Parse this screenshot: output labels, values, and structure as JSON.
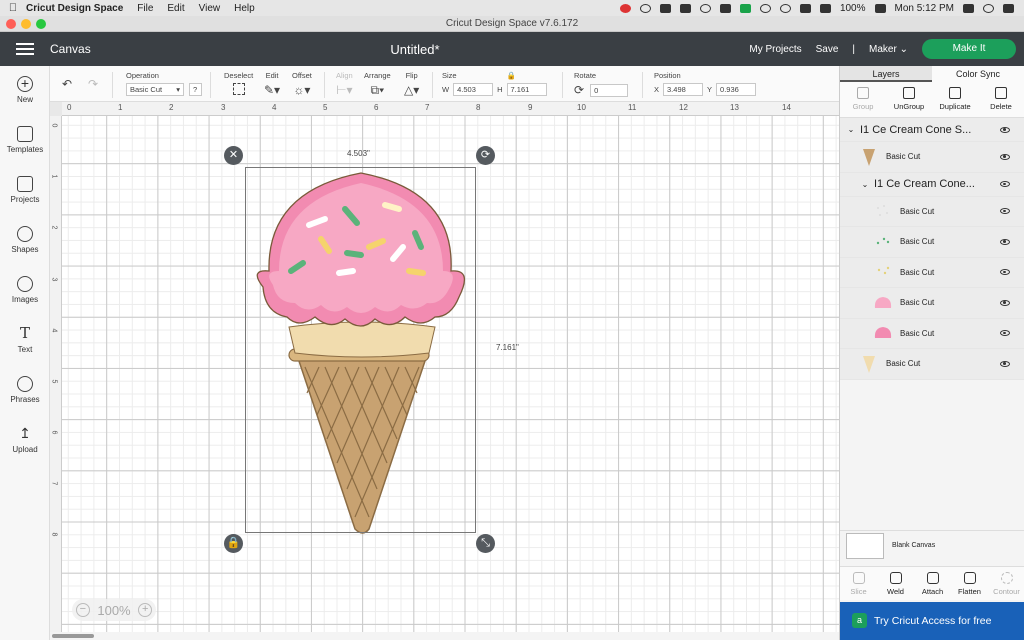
{
  "menubar": {
    "app": "Cricut Design Space",
    "items": [
      "File",
      "Edit",
      "View",
      "Help"
    ],
    "battery": "100%",
    "clock": "Mon 5:12 PM"
  },
  "window": {
    "title": "Cricut Design Space  v7.6.172"
  },
  "header": {
    "section": "Canvas",
    "doc_title": "Untitled*",
    "my_projects": "My Projects",
    "save": "Save",
    "divider": "|",
    "machine": "Maker",
    "make_it": "Make It"
  },
  "lefttools": [
    {
      "label": "New",
      "icon": "plus-icon"
    },
    {
      "label": "Templates",
      "icon": "shirt-icon"
    },
    {
      "label": "Projects",
      "icon": "clipboard-icon"
    },
    {
      "label": "Shapes",
      "icon": "shapes-icon"
    },
    {
      "label": "Images",
      "icon": "lightbulb-icon"
    },
    {
      "label": "Text",
      "icon": "text-icon"
    },
    {
      "label": "Phrases",
      "icon": "speech-bubble-icon"
    },
    {
      "label": "Upload",
      "icon": "upload-icon"
    }
  ],
  "edit_toolbar": {
    "operation_label": "Operation",
    "operation_value": "Basic Cut",
    "help": "?",
    "deselect": "Deselect",
    "edit": "Edit",
    "offset": "Offset",
    "align": "Align",
    "arrange": "Arrange",
    "flip": "Flip",
    "size_label": "Size",
    "w_label": "W",
    "w_value": "4.503",
    "h_label": "H",
    "h_value": "7.161",
    "rotate_label": "Rotate",
    "rotate_value": "0",
    "position_label": "Position",
    "x_label": "X",
    "x_value": "3.498",
    "y_label": "Y",
    "y_value": "0.936"
  },
  "ruler": {
    "h": [
      "0",
      "1",
      "2",
      "3",
      "4",
      "5",
      "6",
      "7",
      "8",
      "9",
      "10",
      "11",
      "12",
      "13",
      "14"
    ],
    "v": [
      "0",
      "1",
      "2",
      "3",
      "4",
      "5",
      "6",
      "7",
      "8"
    ]
  },
  "canvas": {
    "width_label": "4.503\"",
    "height_label": "7.161\"",
    "zoom": "100%"
  },
  "panel": {
    "tab_layers": "Layers",
    "tab_color_sync": "Color Sync",
    "tools": [
      {
        "label": "Group",
        "enabled": false
      },
      {
        "label": "UnGroup",
        "enabled": true
      },
      {
        "label": "Duplicate",
        "enabled": true
      },
      {
        "label": "Delete",
        "enabled": true
      }
    ],
    "layers": [
      {
        "type": "group",
        "label": "I1 Ce Cream Cone S..."
      },
      {
        "type": "item",
        "label": "Basic Cut",
        "thumb": "cone-brown"
      },
      {
        "type": "group",
        "label": "I1 Ce Cream Cone..."
      },
      {
        "type": "item",
        "label": "Basic Cut",
        "thumb": "sprinkles-white"
      },
      {
        "type": "item",
        "label": "Basic Cut",
        "thumb": "sprinkles-green"
      },
      {
        "type": "item",
        "label": "Basic Cut",
        "thumb": "sprinkles-yellow"
      },
      {
        "type": "item",
        "label": "Basic Cut",
        "thumb": "scoop-pink"
      },
      {
        "type": "item",
        "label": "Basic Cut",
        "thumb": "scoop-darkpink"
      },
      {
        "type": "item",
        "label": "Basic Cut",
        "thumb": "cone-tan"
      }
    ],
    "blank_canvas": "Blank Canvas",
    "bottom_tools": [
      {
        "label": "Slice",
        "enabled": false
      },
      {
        "label": "Weld",
        "enabled": true
      },
      {
        "label": "Attach",
        "enabled": true
      },
      {
        "label": "Flatten",
        "enabled": true
      },
      {
        "label": "Contour",
        "enabled": false
      }
    ],
    "access": "Try Cricut Access for free"
  },
  "colors": {
    "header": "#3a3f44",
    "make_it": "#1c9f5b",
    "access_banner": "#1961b8",
    "scoop_pink": "#f7a8c4",
    "scoop_dark": "#f28bb1",
    "cone": "#c8a271",
    "cone_top": "#f1dcae"
  }
}
